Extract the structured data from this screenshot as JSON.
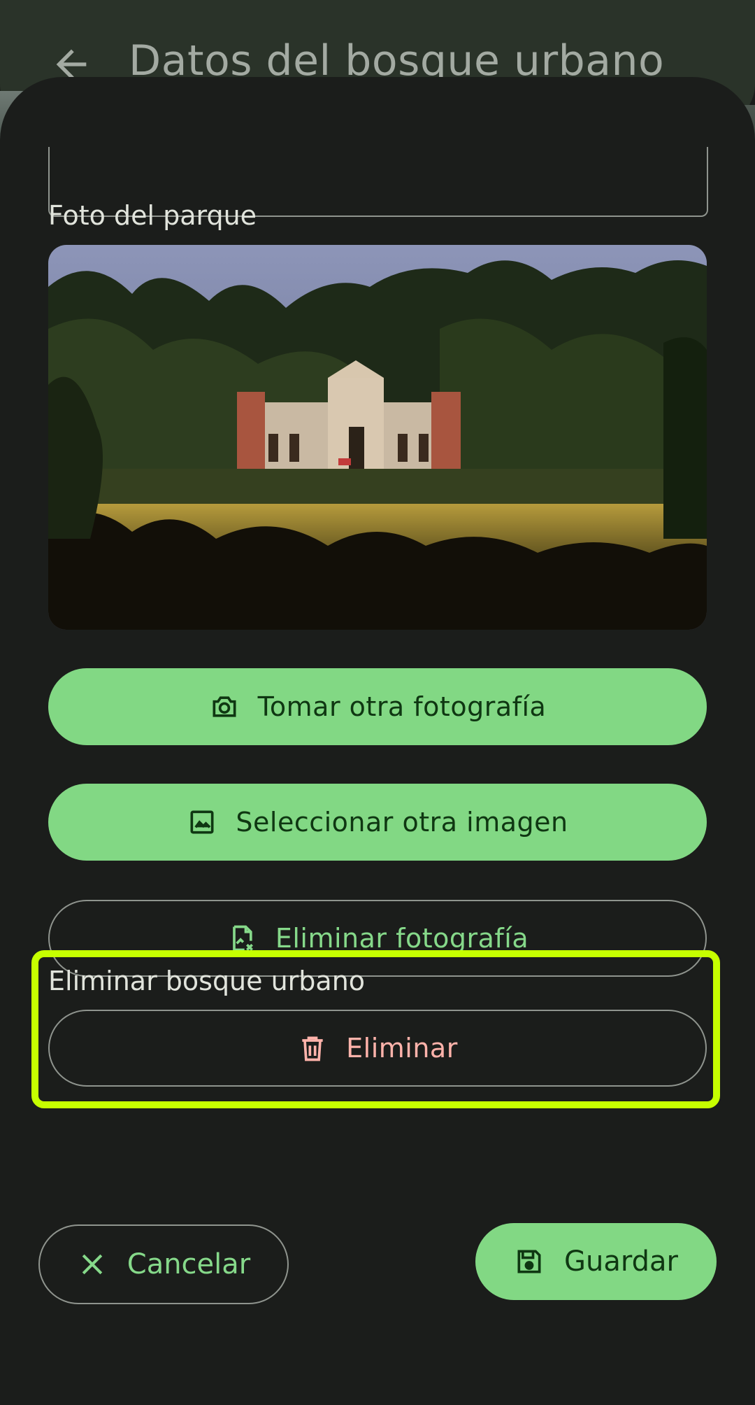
{
  "app_bar": {
    "title": "Datos del bosque urbano",
    "back_icon": "arrow-back-icon"
  },
  "photo_section": {
    "label": "Foto del parque",
    "buttons": {
      "take_photo": {
        "label": "Tomar otra fotografía",
        "icon": "camera-icon"
      },
      "select_image": {
        "label": "Seleccionar otra imagen",
        "icon": "image-icon"
      },
      "delete_photo": {
        "label": "Eliminar fotografía",
        "icon": "image-remove-icon"
      }
    }
  },
  "delete_section": {
    "label": "Eliminar bosque urbano",
    "button": {
      "label": "Eliminar",
      "icon": "trash-icon"
    }
  },
  "footer": {
    "cancel": {
      "label": "Cancelar",
      "icon": "close-icon"
    },
    "save": {
      "label": "Guardar",
      "icon": "save-icon"
    }
  },
  "colors": {
    "background": "#1b1d1b",
    "primary": "#82d884",
    "on_primary": "#0f3712",
    "outline": "#8f948e",
    "error": "#ffb3ab",
    "highlight": "#c6ff00"
  }
}
